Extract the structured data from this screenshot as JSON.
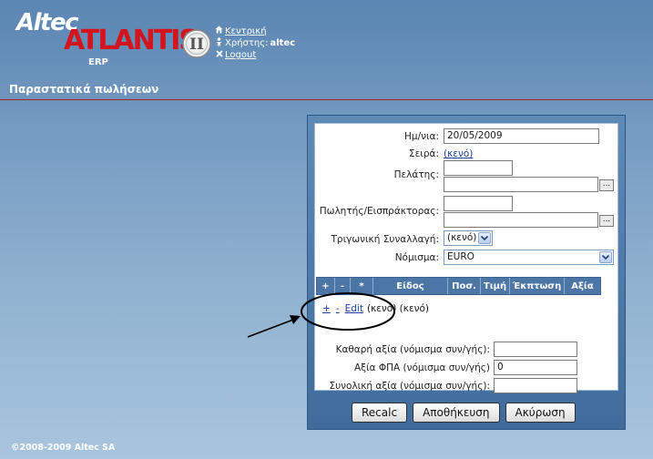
{
  "brand": {
    "altec": "Altec",
    "atlantis": "ATLANTIS",
    "erp": "ERP",
    "roman": "II",
    "colors": {
      "red": "#d4141c",
      "white": "#ffffff"
    }
  },
  "top_links": {
    "home": {
      "icon": "home-icon",
      "label": "Κεντρική"
    },
    "user": {
      "icon": "user-icon",
      "label": "Χρήστης:",
      "value": "altec"
    },
    "logout": {
      "icon": "close-icon",
      "label": "Logout"
    }
  },
  "page": {
    "title": "Παραστατικά πωλήσεων"
  },
  "form": {
    "date": {
      "label": "Ημ/νια:",
      "value": "20/05/2009"
    },
    "series": {
      "label": "Σειρά:",
      "value": "(κενό)"
    },
    "customer": {
      "label": "Πελάτης:",
      "code": "",
      "name": "",
      "lookup": "..."
    },
    "seller": {
      "label": "Πωλητής/Εισπράκτορας:",
      "code": "",
      "name": "",
      "lookup": "..."
    },
    "triangular": {
      "label": "Τριγωνική Συναλλαγή:",
      "value": "(κενό)"
    },
    "currency": {
      "label": "Νόμισμα:",
      "value": "EURO"
    },
    "grid": {
      "columns": [
        "+",
        "-",
        "*",
        "Είδος",
        "Ποσ.",
        "Τιμή",
        "Έκπτωση",
        "Αξία"
      ],
      "row": {
        "add": "+",
        "remove": "-",
        "edit": "Edit",
        "item": "(κενό)",
        "extra": "(κενό)"
      }
    },
    "totals": {
      "net": {
        "label": "Καθαρή αξία (νόμισμα συν/γής):",
        "value": ""
      },
      "vat": {
        "label": "Αξία ΦΠΑ (νόμισμα συν/γής)",
        "value": "0"
      },
      "total": {
        "label": "Συνολική αξία (νόμισμα συν/γής):",
        "value": ""
      }
    }
  },
  "buttons": {
    "recalc": "Recalc",
    "save": "Αποθήκευση",
    "cancel": "Ακύρωση"
  },
  "footer": {
    "copyright": "©2008-2009 Altec SA"
  }
}
